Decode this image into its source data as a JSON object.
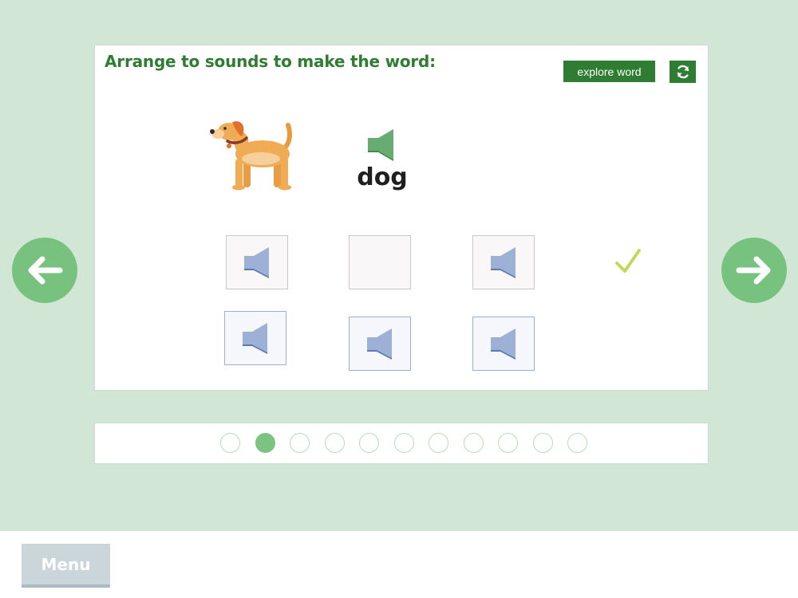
{
  "activity": {
    "instruction": "Arrange to sounds to make the word:",
    "explore_label": "explore word",
    "refresh_icon": "refresh-icon",
    "word": "dog",
    "picture": "dog-illustration",
    "speaker_icon": "speaker-icon",
    "check_icon": "checkmark-icon"
  },
  "answer_slots": [
    {
      "state": "filled",
      "icon": "speaker-icon"
    },
    {
      "state": "empty"
    },
    {
      "state": "filled",
      "icon": "speaker-icon"
    }
  ],
  "sound_tiles": [
    {
      "icon": "speaker-icon"
    },
    {
      "icon": "speaker-icon"
    },
    {
      "icon": "speaker-icon"
    }
  ],
  "navigation": {
    "prev_icon": "arrow-left-icon",
    "next_icon": "arrow-right-icon"
  },
  "progress": {
    "total": 11,
    "current": 2
  },
  "footer": {
    "menu_label": "Menu"
  },
  "colors": {
    "background": "#d2e6d6",
    "accent_green": "#2e7d32",
    "title_green": "#2f7d32",
    "nav_green": "#77c27f",
    "tile_blue": "#9bb0d6",
    "check": "#c0d858"
  }
}
